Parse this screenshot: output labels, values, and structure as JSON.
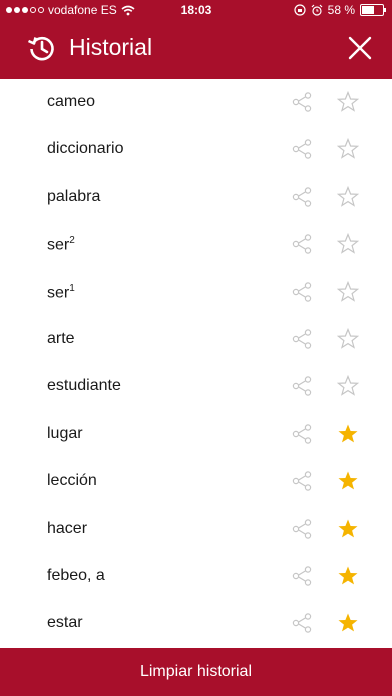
{
  "status_bar": {
    "carrier": "vodafone ES",
    "time": "18:03",
    "battery": "58 %",
    "battery_level": 0.58
  },
  "header": {
    "title": "Historial",
    "background": "#a80f2b"
  },
  "entries": [
    {
      "word": "cameo",
      "sup": "",
      "favorite": false
    },
    {
      "word": "diccionario",
      "sup": "",
      "favorite": false
    },
    {
      "word": "palabra",
      "sup": "",
      "favorite": false
    },
    {
      "word": "ser",
      "sup": "2",
      "favorite": false
    },
    {
      "word": "ser",
      "sup": "1",
      "favorite": false
    },
    {
      "word": "arte",
      "sup": "",
      "favorite": false
    },
    {
      "word": "estudiante",
      "sup": "",
      "favorite": false
    },
    {
      "word": "lugar",
      "sup": "",
      "favorite": true
    },
    {
      "word": "lección",
      "sup": "",
      "favorite": true
    },
    {
      "word": "hacer",
      "sup": "",
      "favorite": true
    },
    {
      "word": "febeo, a",
      "sup": "",
      "favorite": true
    },
    {
      "word": "estar",
      "sup": "",
      "favorite": true
    }
  ],
  "colors": {
    "star_active": "#f5b400",
    "star_inactive": "#c6c6c6",
    "share_icon": "#c6c6c6"
  },
  "footer": {
    "clear_label": "Limpiar historial"
  }
}
